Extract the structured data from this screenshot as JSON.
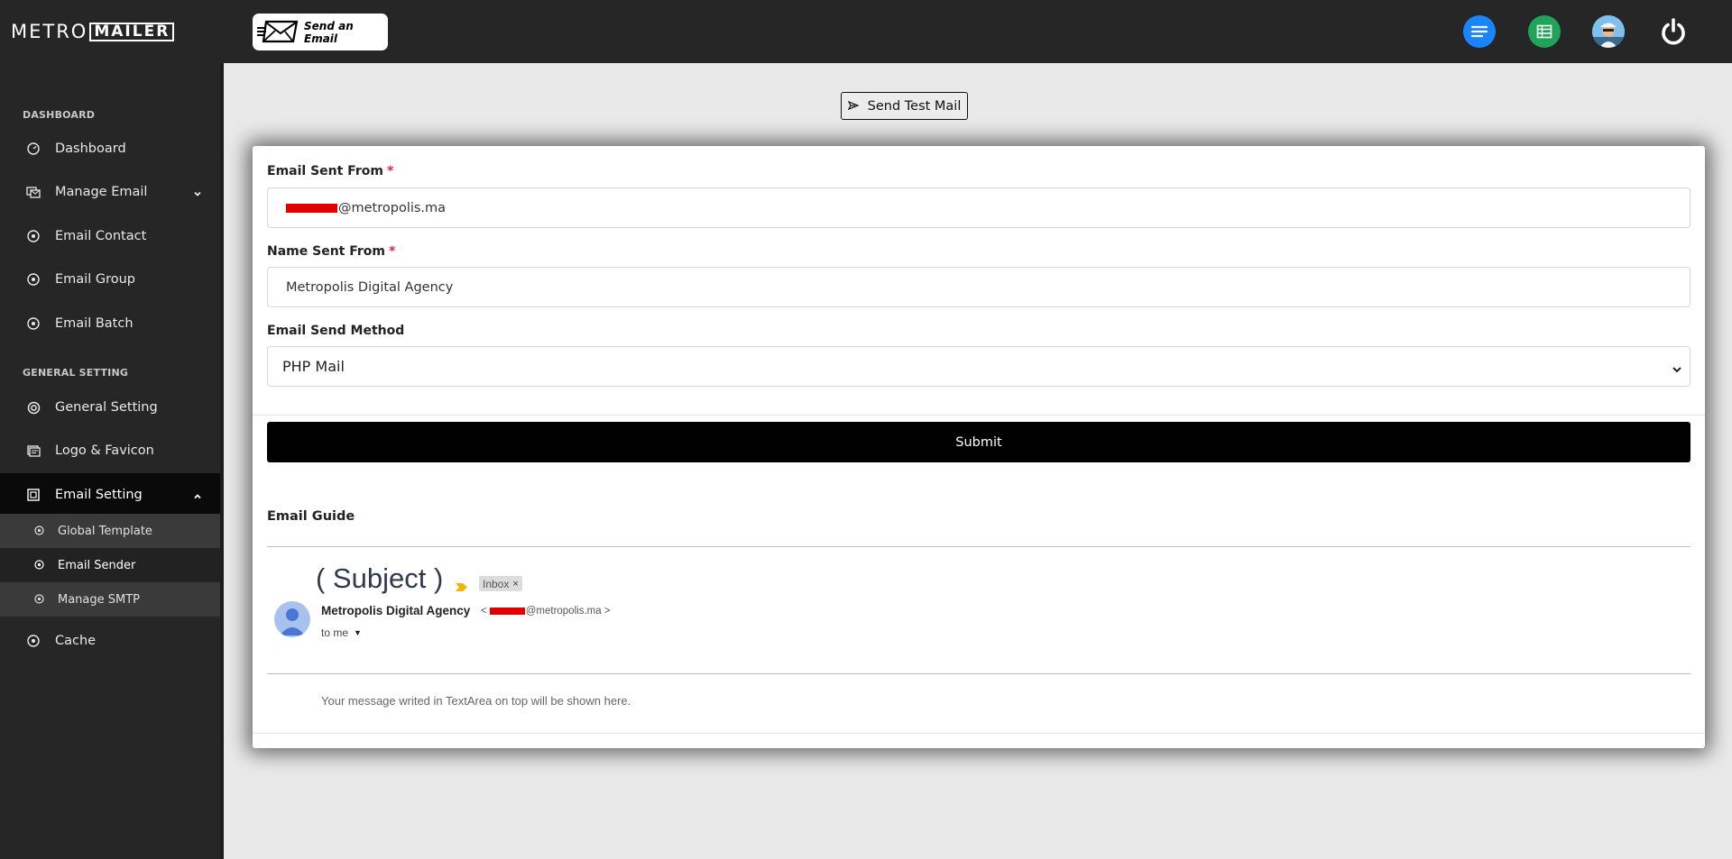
{
  "brand": {
    "part_a": "METRO",
    "part_b": "MAILER"
  },
  "topbar": {
    "send_badge_label": "Send an Email",
    "icons": [
      "menu-icon",
      "spreadsheet-icon",
      "avatar",
      "power-icon"
    ],
    "colors": {
      "menu": "#1a85ff",
      "sheet": "#1fa45a"
    }
  },
  "sidebar": {
    "dashboard_section": "DASHBOARD",
    "general_section": "GENERAL SETTING",
    "items": {
      "dashboard": "Dashboard",
      "manage_email": "Manage Email",
      "email_contact": "Email Contact",
      "email_group": "Email Group",
      "email_batch": "Email Batch",
      "general_setting": "General Setting",
      "logo_favicon": "Logo & Favicon",
      "email_setting": "Email Setting",
      "global_template": "Global Template",
      "email_sender": "Email Sender",
      "manage_smtp": "Manage SMTP",
      "cache": "Cache"
    }
  },
  "main": {
    "test_mail_label": "Send Test Mail",
    "form": {
      "from_label": "Email Sent From",
      "from_value_suffix": "@metropolis.ma",
      "name_label": "Name Sent From",
      "name_value": "Metropolis Digital Agency",
      "method_label": "Email Send Method",
      "method_value": "PHP Mail",
      "required_mark": "*",
      "submit_label": "Submit"
    },
    "guide": {
      "title": "Email Guide",
      "subject": "( Subject )",
      "inbox_chip": "Inbox",
      "chip_close": "×",
      "sender_name": "Metropolis Digital Agency",
      "sender_prefix": "<",
      "sender_mail_suffix": "@metropolis.ma >",
      "to_me": "to me",
      "message_preview": "Your message writed in TextArea on top will be shown here."
    }
  }
}
